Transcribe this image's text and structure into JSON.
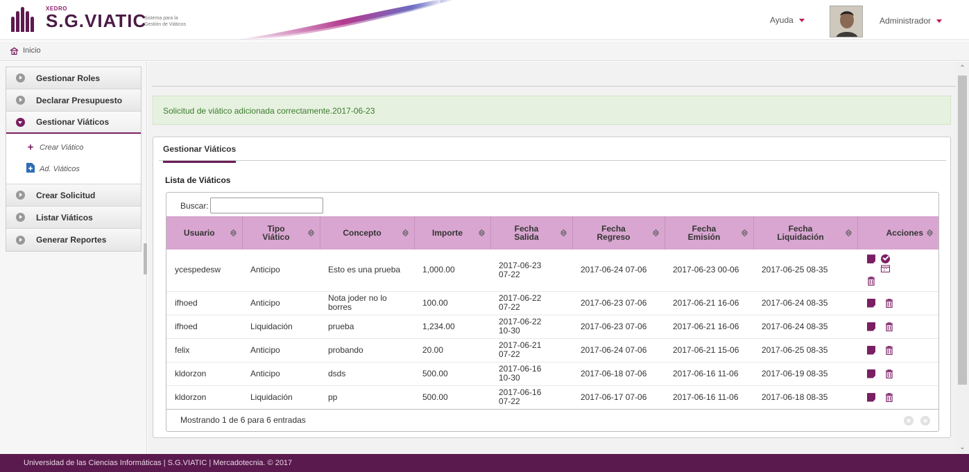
{
  "header": {
    "brand_small": "XEDRO",
    "brand_name": "S.G.VIATIC",
    "brand_subtitle_1": "Sistema para la",
    "brand_subtitle_2": "Gestión de Viáticos",
    "help_label": "Ayuda",
    "user_label": "Administrador"
  },
  "breadcrumb": {
    "home_label": "Inicio"
  },
  "sidebar": {
    "items": [
      {
        "label": "Gestionar Roles"
      },
      {
        "label": "Declarar Presupuesto"
      },
      {
        "label": "Gestionar Viáticos"
      },
      {
        "label": "Crear Solicitud"
      },
      {
        "label": "Listar Viáticos"
      },
      {
        "label": "Generar Reportes"
      }
    ],
    "sub_items": [
      {
        "label": "Crear Viático"
      },
      {
        "label": "Ad. Viáticos"
      }
    ]
  },
  "alert": {
    "message": "Solicitud de viático adicionada correctamente.2017-06-23"
  },
  "panel": {
    "tab_label": "Gestionar Viáticos",
    "list_title": "Lista de Viáticos",
    "search_label": "Buscar:",
    "search_value": "",
    "columns": [
      {
        "line1": "Usuario",
        "line2": ""
      },
      {
        "line1": "Tipo",
        "line2": "Viático"
      },
      {
        "line1": "Concepto",
        "line2": ""
      },
      {
        "line1": "Importe",
        "line2": ""
      },
      {
        "line1": "Fecha",
        "line2": "Salida"
      },
      {
        "line1": "Fecha",
        "line2": "Regreso"
      },
      {
        "line1": "Fecha",
        "line2": "Emisión"
      },
      {
        "line1": "Fecha",
        "line2": "Liquidación"
      },
      {
        "line1": "Acciones",
        "line2": ""
      }
    ],
    "rows": [
      {
        "usuario": "ycespedesw",
        "tipo": "Anticipo",
        "concepto": "Esto es una prueba",
        "importe": "1,000.00",
        "salida_1": "2017-06-23",
        "salida_2": "07-22",
        "regreso": "2017-06-24 07-06",
        "emision": "2017-06-23 00-06",
        "liquidacion": "2017-06-25 08-35"
      },
      {
        "usuario": "ifhoed",
        "tipo": "Anticipo",
        "concepto": "Nota joder no lo borres",
        "importe": "100.00",
        "salida_1": "2017-06-22",
        "salida_2": "07-22",
        "regreso": "2017-06-23 07-06",
        "emision": "2017-06-21 16-06",
        "liquidacion": "2017-06-24 08-35"
      },
      {
        "usuario": "ifhoed",
        "tipo": "Liquidación",
        "concepto": "prueba",
        "importe": "1,234.00",
        "salida_1": "2017-06-22",
        "salida_2": "10-30",
        "regreso": "2017-06-23 07-06",
        "emision": "2017-06-21 16-06",
        "liquidacion": "2017-06-24 08-35"
      },
      {
        "usuario": "felix",
        "tipo": "Anticipo",
        "concepto": "probando",
        "importe": "20.00",
        "salida_1": "2017-06-21",
        "salida_2": "07-22",
        "regreso": "2017-06-24 07-06",
        "emision": "2017-06-21 15-06",
        "liquidacion": "2017-06-25 08-35"
      },
      {
        "usuario": "kldorzon",
        "tipo": "Anticipo",
        "concepto": "dsds",
        "importe": "500.00",
        "salida_1": "2017-06-16",
        "salida_2": "10-30",
        "regreso": "2017-06-18 07-06",
        "emision": "2017-06-16 11-06",
        "liquidacion": "2017-06-19 08-35"
      },
      {
        "usuario": "kldorzon",
        "tipo": "Liquidación",
        "concepto": "pp",
        "importe": "500.00",
        "salida_1": "2017-06-16",
        "salida_2": "07-22",
        "regreso": "2017-06-17 07-06",
        "emision": "2017-06-16 11-06",
        "liquidacion": "2017-06-18 08-35"
      }
    ],
    "info": "Mostrando 1 de 6 para 6 entradas"
  },
  "footer": {
    "text": "Universidad de las Ciencias Informáticas | S.G.VIATIC | Mercadotecnia. © 2017"
  },
  "colors": {
    "brand": "#5a1a4e",
    "accent": "#7a1f63",
    "table_header": "#d8a6d0",
    "alert_bg": "#e6f2df",
    "alert_text": "#3c7a2f"
  }
}
